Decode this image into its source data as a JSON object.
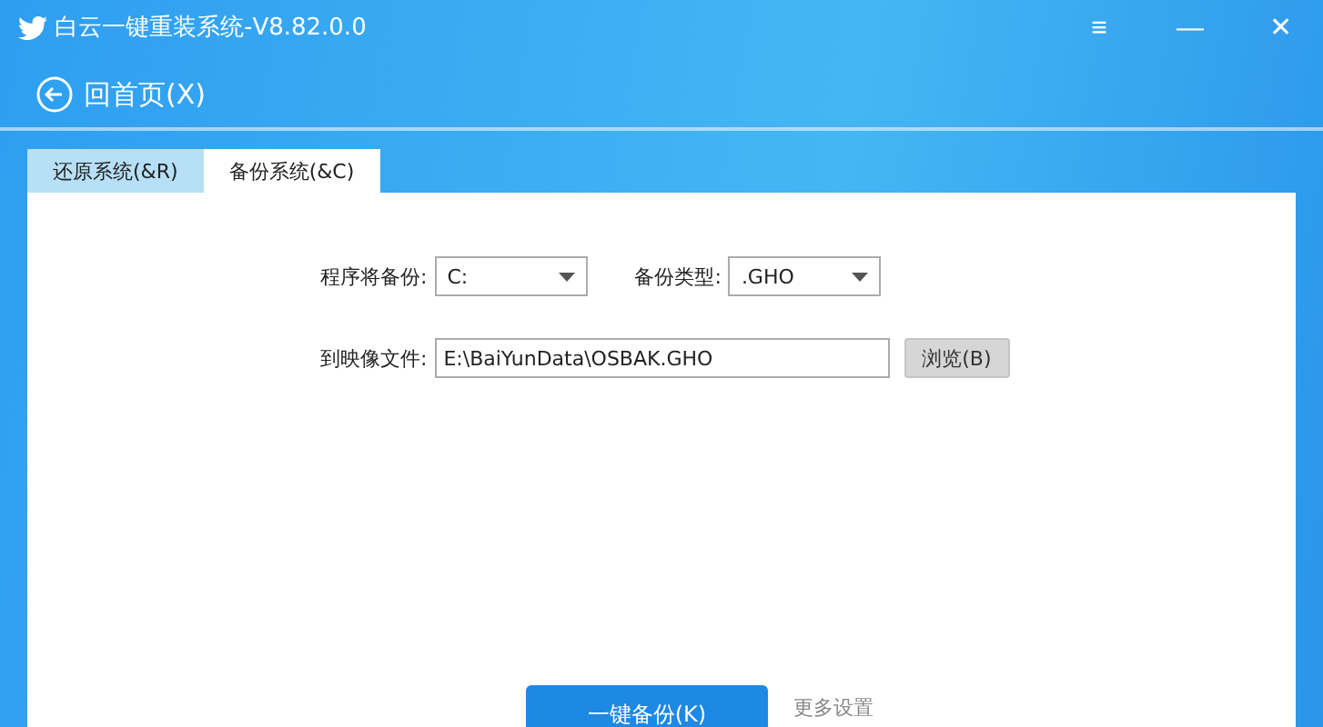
{
  "window": {
    "title": "白云一键重装系统-V8.82.0.0",
    "controls": [
      "≡",
      "—",
      "✕"
    ]
  },
  "nav": {
    "back": "回首页(X)"
  },
  "tabs": [
    {
      "label": "还原系统(&R)",
      "selected": false
    },
    {
      "label": "备份系统(&C)",
      "selected": true
    }
  ],
  "form": {
    "source_label": "程序将备份:",
    "source_value": "C:",
    "type_label": "备份类型:",
    "type_value": ".GHO",
    "file_label": "到映像文件:",
    "file_value": "E:\\BaiYunData\\OSBAK.GHO",
    "browse": "浏览(B)"
  },
  "actions": {
    "primary": "一键备份(K)",
    "more": "更多设置"
  }
}
